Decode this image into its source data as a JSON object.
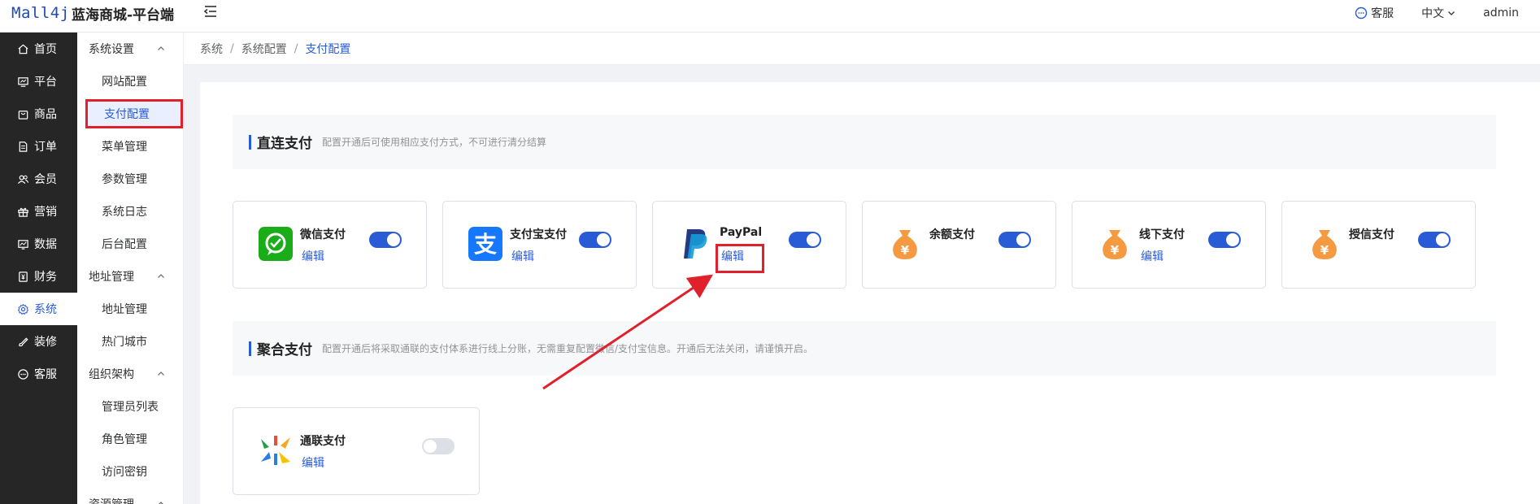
{
  "header": {
    "logo": "Mall4j",
    "title": "蓝海商城-平台端",
    "service_label": "客服",
    "language_label": "中文",
    "user_label": "admin"
  },
  "nav_primary": [
    {
      "label": "首页",
      "icon": "home-icon"
    },
    {
      "label": "平台",
      "icon": "monitor-icon"
    },
    {
      "label": "商品",
      "icon": "bag-icon"
    },
    {
      "label": "订单",
      "icon": "document-icon"
    },
    {
      "label": "会员",
      "icon": "users-icon"
    },
    {
      "label": "营销",
      "icon": "gift-icon"
    },
    {
      "label": "数据",
      "icon": "chart-icon"
    },
    {
      "label": "财务",
      "icon": "finance-icon"
    },
    {
      "label": "系统",
      "icon": "gear-icon",
      "active": true
    },
    {
      "label": "装修",
      "icon": "brush-icon"
    },
    {
      "label": "客服",
      "icon": "chat-icon"
    }
  ],
  "nav_secondary": {
    "groups": [
      {
        "label": "系统设置",
        "items": [
          "网站配置",
          "支付配置",
          "菜单管理",
          "参数管理",
          "系统日志",
          "后台配置"
        ]
      },
      {
        "label": "地址管理",
        "items": [
          "地址管理",
          "热门城市"
        ]
      },
      {
        "label": "组织架构",
        "items": [
          "管理员列表",
          "角色管理",
          "访问密钥"
        ]
      },
      {
        "label": "资源管理",
        "items": []
      }
    ],
    "active_item": "支付配置"
  },
  "breadcrumb": [
    "系统",
    "系统配置",
    "支付配置"
  ],
  "sections": {
    "direct": {
      "title": "直连支付",
      "desc": "配置开通后可使用相应支付方式，不可进行清分结算",
      "methods": [
        {
          "name": "微信支付",
          "edit": "编辑",
          "enabled": true,
          "icon": "wechat-pay-icon"
        },
        {
          "name": "支付宝支付",
          "edit": "编辑",
          "enabled": true,
          "icon": "alipay-icon"
        },
        {
          "name": "PayPal",
          "edit": "编辑",
          "enabled": true,
          "icon": "paypal-icon"
        },
        {
          "name": "余额支付",
          "edit": "",
          "enabled": true,
          "icon": "money-bag-icon"
        },
        {
          "name": "线下支付",
          "edit": "编辑",
          "enabled": true,
          "icon": "money-bag-icon"
        },
        {
          "name": "授信支付",
          "edit": "",
          "enabled": true,
          "icon": "money-bag-icon"
        }
      ]
    },
    "aggregate": {
      "title": "聚合支付",
      "desc": "配置开通后将采取通联的支付体系进行线上分账，无需重复配置微信/支付宝信息。开通后无法关闭，请谨慎开启。",
      "methods": [
        {
          "name": "通联支付",
          "edit": "编辑",
          "enabled": false,
          "icon": "allinpay-icon"
        }
      ]
    }
  },
  "colors": {
    "accent": "#2a5bd7",
    "sidebar_bg": "#262626",
    "annotation": "#e0202a"
  }
}
